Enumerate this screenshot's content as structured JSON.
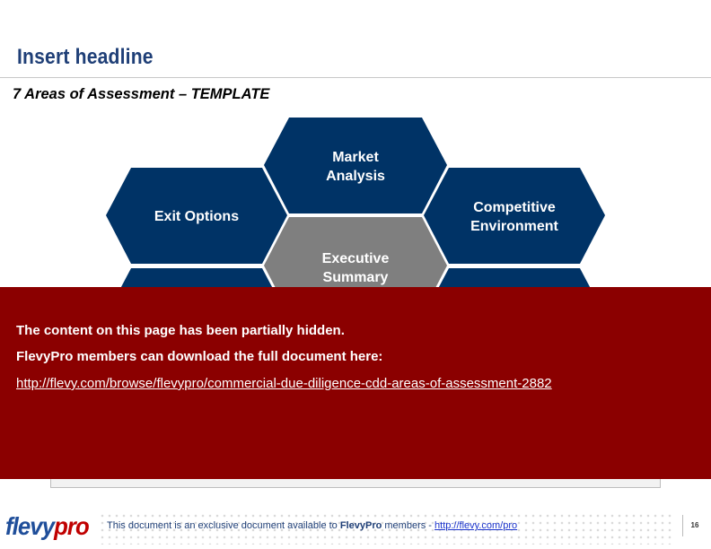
{
  "header": {
    "headline": "Insert headline",
    "subtitle": "7 Areas of Assessment – TEMPLATE"
  },
  "diagram": {
    "hexagons": [
      {
        "id": "market-analysis",
        "lines": [
          "Market",
          "Analysis"
        ],
        "color": "#003366"
      },
      {
        "id": "exit-options",
        "lines": [
          "Exit Options"
        ],
        "color": "#003366"
      },
      {
        "id": "competitive-environment",
        "lines": [
          "Competitive",
          "Environment"
        ],
        "color": "#003366"
      },
      {
        "id": "executive-summary",
        "lines": [
          "Executive",
          "Summary"
        ],
        "color": "#7f7f7f"
      },
      {
        "id": "hidden-left",
        "lines": [],
        "color": "#003366"
      },
      {
        "id": "hidden-right",
        "lines": [],
        "color": "#003366"
      }
    ]
  },
  "overlay": {
    "line1": "The content on this page has been partially hidden.",
    "line2": "FlevyPro members can download the full document here:",
    "link": "http://flevy.com/browse/flevypro/commercial-due-diligence-cdd-areas-of-assessment-2882",
    "color": "#8b0000"
  },
  "footer": {
    "logo_part1": "flevy",
    "logo_part2": "pro",
    "text_before": "This document is an exclusive document available to ",
    "brand": "FlevyPro",
    "text_middle": " members - ",
    "link": "http://flevy.com/pro",
    "page_number": "16"
  }
}
